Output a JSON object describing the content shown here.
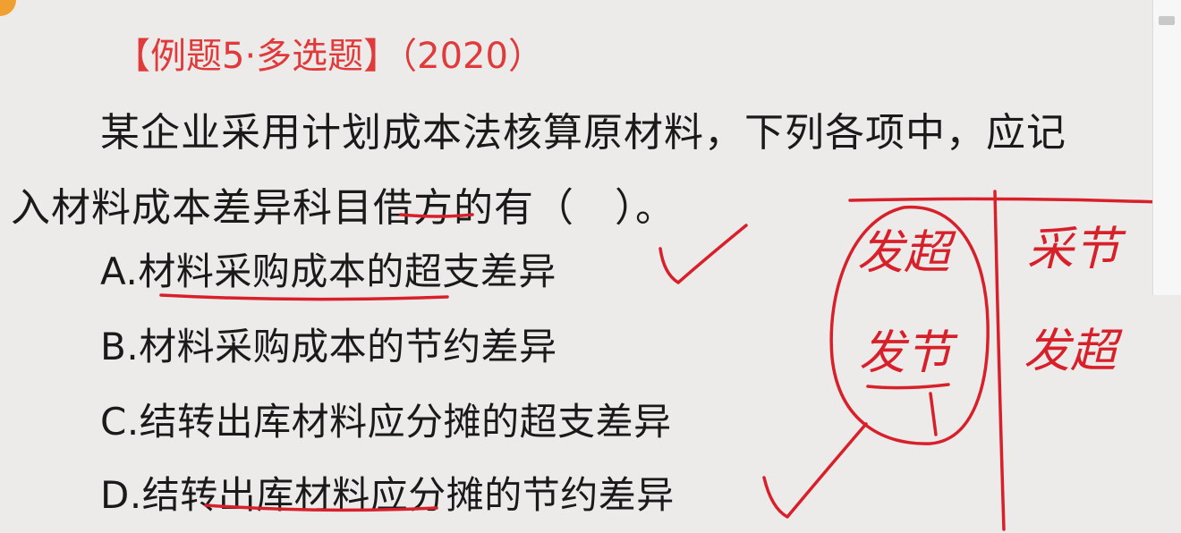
{
  "question": {
    "title": "【例题5·多选题】（2020）",
    "line1": "某企业采用计划成本法核算原材料，下列各项中，应记",
    "line2": "入材料成本差异科目借方的有（　）。",
    "options": [
      {
        "text": "A.材料采购成本的超支差异"
      },
      {
        "text": "B.材料采购成本的节约差异"
      },
      {
        "text": "C.结转出库材料应分摊的超支差异"
      },
      {
        "text": "D.结转出库材料应分摊的节约差异"
      }
    ]
  },
  "annotations": {
    "left_top": "发超",
    "left_bottom": "发节",
    "right_top": "采节",
    "right_bottom": "发超"
  },
  "colors": {
    "title": "#e03a3a",
    "ink": "#d8202a",
    "text": "#1a1a1a",
    "background": "#ecebea"
  }
}
